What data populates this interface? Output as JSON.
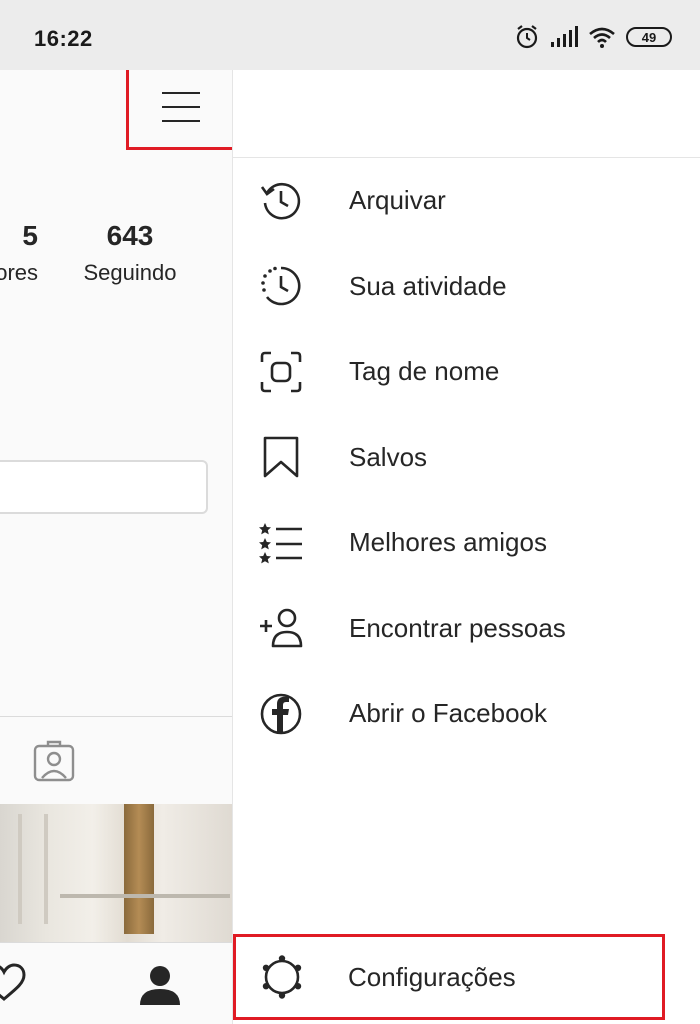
{
  "status_bar": {
    "time": "16:22",
    "battery": "49",
    "icons": [
      "alarm-icon",
      "signal-icon",
      "wifi-icon",
      "battery-icon"
    ]
  },
  "profile": {
    "stats": [
      {
        "number": "5",
        "label": "ores"
      },
      {
        "number": "643",
        "label": "Seguindo"
      }
    ]
  },
  "drawer": {
    "menu": [
      {
        "label": "Arquivar",
        "icon": "archive-icon"
      },
      {
        "label": "Sua atividade",
        "icon": "activity-icon"
      },
      {
        "label": "Tag de nome",
        "icon": "nametag-icon"
      },
      {
        "label": "Salvos",
        "icon": "bookmark-icon"
      },
      {
        "label": "Melhores amigos",
        "icon": "close-friends-icon"
      },
      {
        "label": "Encontrar pessoas",
        "icon": "add-person-icon"
      },
      {
        "label": "Abrir o Facebook",
        "icon": "facebook-icon"
      }
    ],
    "settings": {
      "label": "Configurações",
      "icon": "gear-icon"
    }
  },
  "colors": {
    "highlight": "#e01b24",
    "text": "#262626"
  }
}
